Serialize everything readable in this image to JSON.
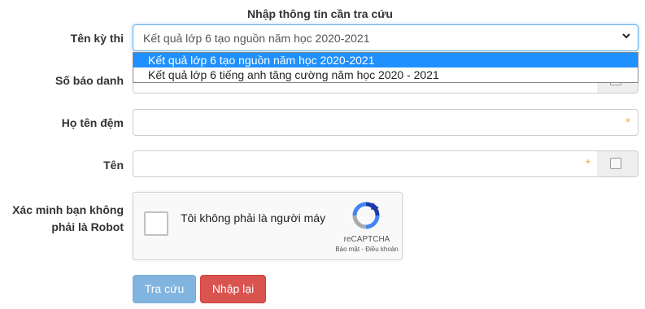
{
  "form": {
    "title": "Nhập thông tin cần tra cứu",
    "exam_label": "Tên kỳ thi",
    "exam_selected": "Kết quả lớp 6 tạo nguồn năm học 2020-2021",
    "exam_options": [
      "Kết quả lớp 6 tạo nguồn năm học 2020-2021",
      "Kết quả lớp 6 tiếng anh tăng cường năm học 2020 - 2021"
    ],
    "sbd_label": "Số báo danh",
    "surname_label": "Họ tên đệm",
    "name_label": "Tên",
    "required_mark": "*",
    "robot_label_line1": "Xác minh bạn không",
    "robot_label_line2": "phải là Robot",
    "search_button": "Tra cứu",
    "reset_button": "Nhập lại"
  },
  "captcha": {
    "text": "Tôi không phải là người máy",
    "brand": "reCAPTCHA",
    "links": "Bảo mật - Điều khoản"
  },
  "colors": {
    "accent_blue": "#1e90ff",
    "search_button": "#82b4e0",
    "reset_button": "#d9534f",
    "required": "#f0ad4e"
  }
}
